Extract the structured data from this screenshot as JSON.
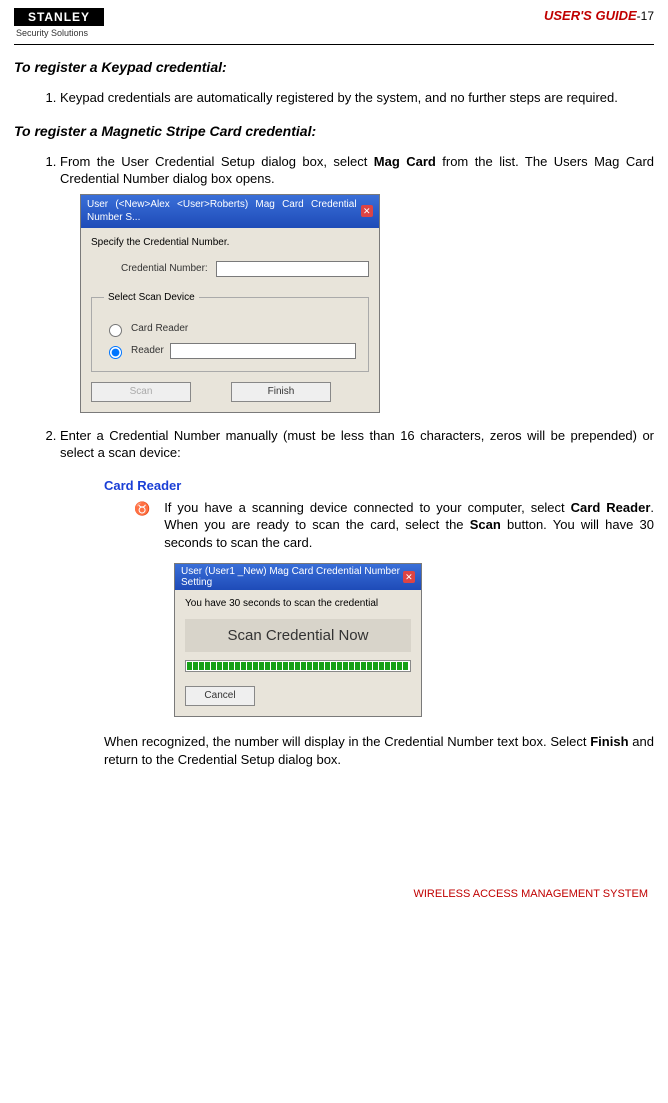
{
  "header": {
    "brand_top": "STANLEY",
    "brand_bottom": "Security Solutions",
    "guide_label": "USER'S GUIDE",
    "page_sep": "-",
    "page_num": "17"
  },
  "section_keypad": {
    "title": "To register a Keypad credential:",
    "items": [
      "Keypad credentials are automatically registered by the system, and no further steps are required."
    ]
  },
  "section_mag": {
    "title": "To register a Magnetic Stripe Card credential:",
    "item1_pre": "From the User Credential Setup dialog box, select ",
    "item1_bold": "Mag Card",
    "item1_post": " from the list.   The Users Mag Card Credential Number dialog box opens.",
    "item2": "Enter a Credential Number manually (must be less than 16 characters, zeros will be prepended) or select a scan device:"
  },
  "dialog1": {
    "title": "User (<New>Alex <User>Roberts) Mag Card Credential Number S...",
    "instruction": "Specify the Credential Number.",
    "cred_label": "Credential Number:",
    "cred_value": "",
    "fieldset_legend": "Select Scan Device",
    "radio_card": "Card Reader",
    "radio_reader": "Reader",
    "reader_value": "",
    "btn_scan": "Scan",
    "btn_finish": "Finish"
  },
  "card_reader": {
    "heading": "Card Reader",
    "bullet_pre": "If you have a scanning device connected to your computer, select ",
    "bullet_bold1": "Card Reader",
    "bullet_mid": ".    When you are ready to scan the card, select the ",
    "bullet_bold2": "Scan",
    "bullet_post": " button.   You will have 30 seconds to scan the card."
  },
  "dialog2": {
    "title": "User (User1 _New) Mag Card Credential Number Setting",
    "instruction": "You have 30 seconds to scan the credential",
    "banner": "Scan Credential Now",
    "btn_cancel": "Cancel"
  },
  "post_text_pre": "When recognized, the number will display in the Credential Number text box. Select ",
  "post_text_bold": "Finish",
  "post_text_post": " and return to the Credential Setup dialog box.",
  "footer": "WIRELESS ACCESS MANAGEMENT SYSTEM"
}
